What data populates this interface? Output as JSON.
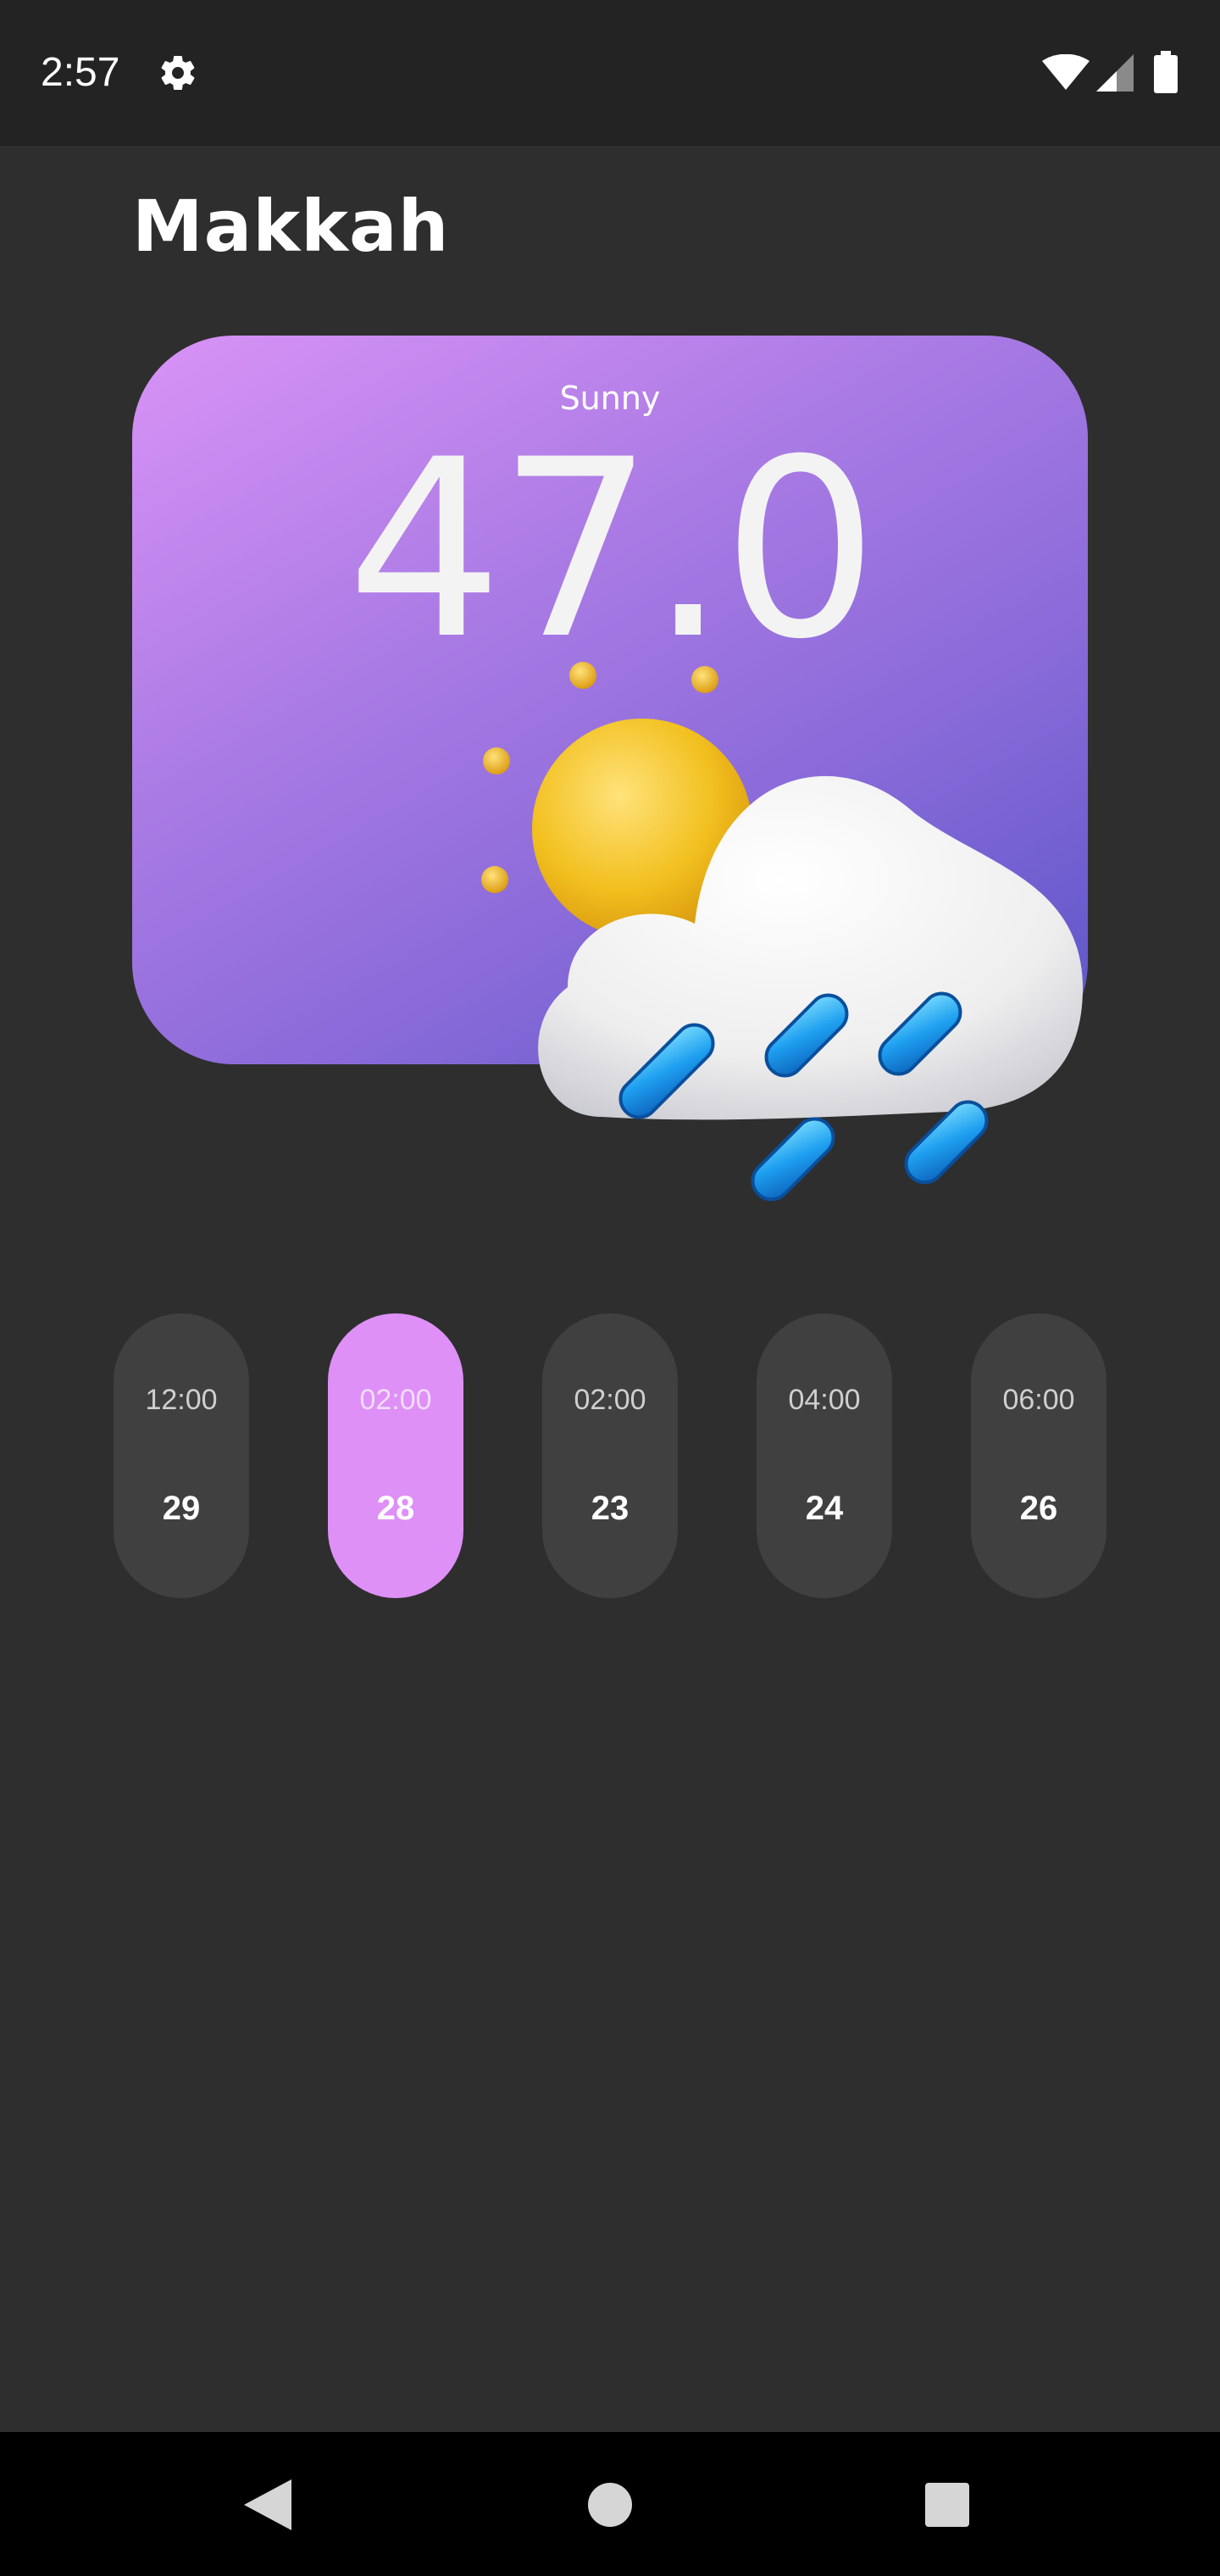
{
  "status_bar": {
    "time": "2:57",
    "icons": [
      "gear-icon",
      "wifi-icon",
      "signal-icon",
      "battery-icon"
    ]
  },
  "city": "Makkah",
  "current": {
    "condition": "Sunny",
    "temperature": "47.0",
    "illustration": "sun-cloud-rain-icon"
  },
  "hourly": [
    {
      "time": "12:00",
      "temp": "29",
      "selected": false
    },
    {
      "time": "02:00",
      "temp": "28",
      "selected": true
    },
    {
      "time": "02:00",
      "temp": "23",
      "selected": false
    },
    {
      "time": "04:00",
      "temp": "24",
      "selected": false
    },
    {
      "time": "06:00",
      "temp": "26",
      "selected": false
    }
  ],
  "colors": {
    "background": "#2e2e2e",
    "card_gradient_start": "#d993f6",
    "card_gradient_end": "#5b55c8",
    "hour_item": "#404040",
    "hour_item_selected": "#de90f6"
  },
  "nav_bar": {
    "icons": [
      "back-icon",
      "home-icon",
      "recents-icon"
    ]
  }
}
